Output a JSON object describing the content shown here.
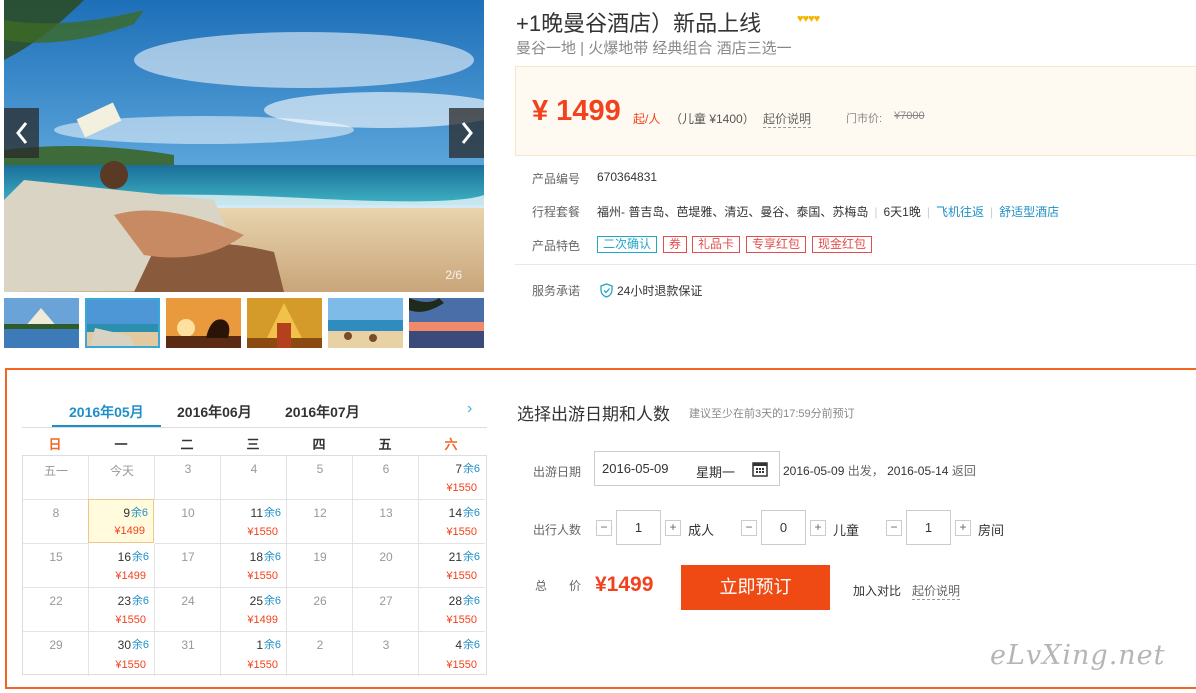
{
  "product": {
    "title": "+1晚曼谷酒店）新品上线",
    "stars": "♥♥♥♥",
    "subtitle": "曼谷一地 | 火爆地带 经典组合 酒店三选一",
    "price": "¥ 1499",
    "price_suffix": "起/人",
    "child_price": "（儿童 ¥1400）",
    "price_explain": "起价说明",
    "market_label": "门市价:",
    "market_price": "¥7000",
    "code_label": "产品编号",
    "code_value": "670364831",
    "route_label": "行程套餐",
    "route_value": "福州- 普吉岛、芭堤雅、清迈、曼谷、泰国、苏梅岛",
    "route_days": "6天1晚",
    "route_flight": "飞机往返",
    "route_hotel": "舒适型酒店",
    "features_label": "产品特色",
    "tags": [
      "二次确认",
      "券",
      "礼品卡",
      "专享红包",
      "现金红包"
    ],
    "service_label": "服务承诺",
    "service_value": "24小时退款保证"
  },
  "gallery": {
    "counter": "2/6",
    "thumbs": [
      "temple-thumb",
      "beach-reading-thumb",
      "elephant-sunset-thumb",
      "golden-temple-thumb",
      "resort-beach-thumb",
      "palm-sunset-thumb"
    ],
    "active_thumb": 1
  },
  "calendar": {
    "months": [
      "2016年05月",
      "2016年06月",
      "2016年07月"
    ],
    "active_month": 0,
    "weekdays": [
      "日",
      "一",
      "二",
      "三",
      "四",
      "五",
      "六"
    ],
    "remain_label": "余6",
    "weeks": [
      [
        {
          "d": "五一"
        },
        {
          "d": "今天"
        },
        {
          "d": "3"
        },
        {
          "d": "4"
        },
        {
          "d": "5"
        },
        {
          "d": "6"
        },
        {
          "d": "7",
          "p": "¥1550"
        }
      ],
      [
        {
          "d": "8"
        },
        {
          "d": "9",
          "p": "¥1499",
          "sel": true
        },
        {
          "d": "10"
        },
        {
          "d": "11",
          "p": "¥1550"
        },
        {
          "d": "12"
        },
        {
          "d": "13"
        },
        {
          "d": "14",
          "p": "¥1550"
        }
      ],
      [
        {
          "d": "15"
        },
        {
          "d": "16",
          "p": "¥1499"
        },
        {
          "d": "17"
        },
        {
          "d": "18",
          "p": "¥1550"
        },
        {
          "d": "19"
        },
        {
          "d": "20"
        },
        {
          "d": "21",
          "p": "¥1550"
        }
      ],
      [
        {
          "d": "22"
        },
        {
          "d": "23",
          "p": "¥1550"
        },
        {
          "d": "24"
        },
        {
          "d": "25",
          "p": "¥1499"
        },
        {
          "d": "26"
        },
        {
          "d": "27"
        },
        {
          "d": "28",
          "p": "¥1550"
        }
      ],
      [
        {
          "d": "29"
        },
        {
          "d": "30",
          "p": "¥1550"
        },
        {
          "d": "31"
        },
        {
          "d": "1",
          "p": "¥1550"
        },
        {
          "d": "2"
        },
        {
          "d": "3"
        },
        {
          "d": "4",
          "p": "¥1550"
        }
      ]
    ]
  },
  "booking": {
    "title": "选择出游日期和人数",
    "hint": "建议至少在前3天的17:59分前预订",
    "date_label": "出游日期",
    "date_value": "2016-05-09",
    "date_weekday": "星期一",
    "depart_date": "2016-05-09",
    "depart_text": "出发，",
    "return_date": "2016-05-14",
    "return_text": "返回",
    "people_label": "出行人数",
    "adults": "1",
    "adults_label": "成人",
    "children": "0",
    "children_label": "儿童",
    "rooms": "1",
    "rooms_label": "房间",
    "minus": "−",
    "plus": "+",
    "total_label": "总价",
    "total_price": "¥1499",
    "book_button": "立即预订",
    "compare": "加入对比",
    "explain": "起价说明"
  },
  "watermark": "eLvXing.net"
}
